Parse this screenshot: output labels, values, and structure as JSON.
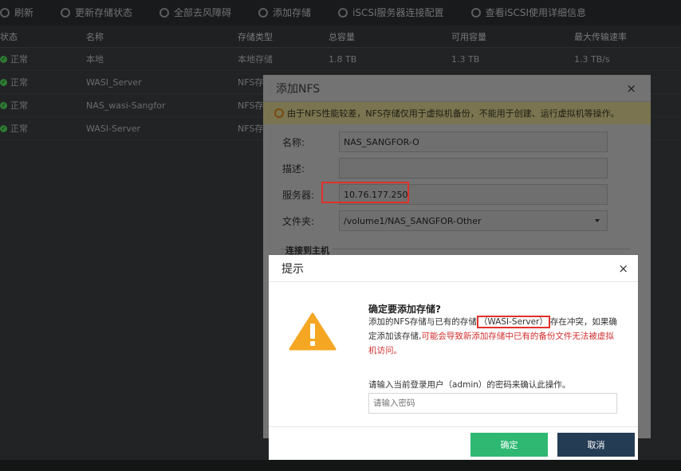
{
  "toolbar": {
    "items": [
      {
        "label": "刷新",
        "icon": "refresh-icon"
      },
      {
        "label": "更新存储状态",
        "icon": "sync-icon"
      },
      {
        "label": "全部去风障碍",
        "icon": "check-icon"
      },
      {
        "label": "添加存储",
        "icon": "plus-icon"
      },
      {
        "label": "iSCSI服务器连接配置",
        "icon": "iscsi-icon"
      },
      {
        "label": "查看iSCSI使用详细信息",
        "icon": "info-icon"
      }
    ]
  },
  "table": {
    "headers": [
      "状态",
      "名称",
      "存储类型",
      "总容量",
      "可用容量",
      "最大传输速率"
    ],
    "rows": [
      {
        "status": "正常",
        "name": "本地",
        "type": "本地存储",
        "total": "1.8 TB",
        "free": "1.3 TB",
        "rate": "1.3 TB/s"
      },
      {
        "status": "正常",
        "name": "WASI_Server",
        "type": "NFS存储",
        "total": "",
        "free": "",
        "rate": ""
      },
      {
        "status": "正常",
        "name": "NAS_wasi-Sangfor",
        "type": "NFS存储",
        "total": "",
        "free": "",
        "rate": ""
      },
      {
        "status": "正常",
        "name": "WASI-Server",
        "type": "NFS存储",
        "total": "",
        "free": "",
        "rate": ""
      }
    ]
  },
  "nfs_dialog": {
    "title": "添加NFS",
    "close_icon": "×",
    "tip": "由于NFS性能较差，NFS存储仅用于虚拟机备份，不能用于创建、运行虚拟机等操作。",
    "fields": {
      "name_label": "名称:",
      "name_value": "NAS_SANGFOR-O",
      "desc_label": "描述:",
      "desc_value": "",
      "server_label": "服务器:",
      "server_value": "10.76.177.250",
      "folder_label": "文件夹:",
      "folder_value": "/volume1/NAS_SANGFOR-Other"
    },
    "host_section": "连接到主机"
  },
  "prompt": {
    "title": "提示",
    "close_icon": "×",
    "confirm_title": "确定要添加存储?",
    "desc_part1": "添加的NFS存储与已有的存储",
    "conflict_name": "（WASI-Server）",
    "desc_part2": "存在冲突，如果确定添加该存储,",
    "desc_red": "可能会导致新添加存储中已有的备份文件无法被虚拟机访问。",
    "pwd_label": "请输入当前登录用户（admin）的密码来确认此操作。",
    "pwd_placeholder": "请输入密码",
    "ok_label": "确定",
    "cancel_label": "取消"
  },
  "colors": {
    "ok_button": "#2eb872",
    "cancel_button": "#253c55",
    "highlight_border": "#e0312b",
    "warning_icon": "#f5a623"
  }
}
